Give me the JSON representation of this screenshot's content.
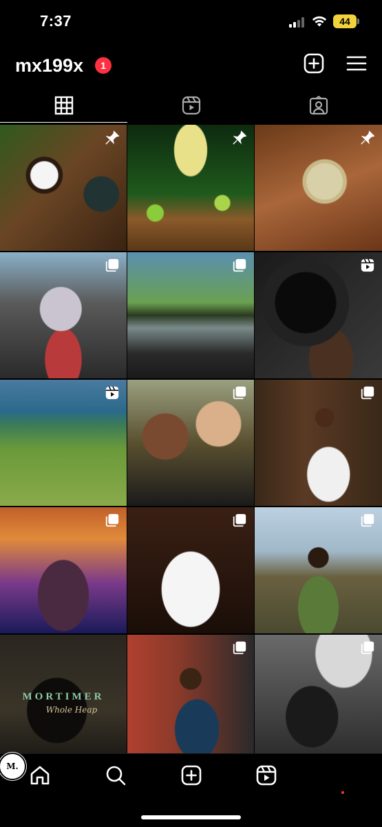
{
  "status_bar": {
    "time": "7:37",
    "battery": "44"
  },
  "profile": {
    "username": "mx199x",
    "notification_count": "1"
  },
  "header_icons": {
    "create": "plus-square-icon",
    "menu": "hamburger-menu-icon"
  },
  "tabs": [
    {
      "name": "posts-grid",
      "icon": "grid-icon",
      "active": true
    },
    {
      "name": "reels",
      "icon": "reels-icon",
      "active": false
    },
    {
      "name": "tagged",
      "icon": "tagged-person-icon",
      "active": false
    }
  ],
  "posts": [
    {
      "subject": "coffee and camera flat lay",
      "badge": "pinned"
    },
    {
      "subject": "margarita cocktail with limes",
      "badge": "pinned"
    },
    {
      "subject": "cocktail garnish with tweezers",
      "badge": "pinned"
    },
    {
      "subject": "carnival costume portrait",
      "badge": "carousel"
    },
    {
      "subject": "friends by a car",
      "badge": "carousel"
    },
    {
      "subject": "camera lens in hand",
      "badge": "reel"
    },
    {
      "subject": "coastline aerial view",
      "badge": "reel"
    },
    {
      "subject": "mother and child",
      "badge": "carousel"
    },
    {
      "subject": "bride with bouquet",
      "badge": "carousel"
    },
    {
      "subject": "portrait in orange and purple light",
      "badge": "carousel"
    },
    {
      "subject": "plated grilled dish",
      "badge": "carousel"
    },
    {
      "subject": "man in floral shirt on hillside",
      "badge": "carousel"
    },
    {
      "subject": "album cover",
      "badge": "none",
      "caption": "MORTIMER",
      "caption_script": "Whole Heap"
    },
    {
      "subject": "man in sunglasses and denim jacket",
      "badge": "carousel"
    },
    {
      "subject": "rapper performing on stage",
      "badge": "carousel"
    }
  ],
  "bottom_nav": {
    "items": [
      "home-icon",
      "search-icon",
      "create-icon",
      "reels-icon"
    ],
    "profile_initial": "M."
  },
  "colors": {
    "background": "#000000",
    "badge_red": "#ff3040",
    "battery_yellow": "#f2d33c"
  }
}
